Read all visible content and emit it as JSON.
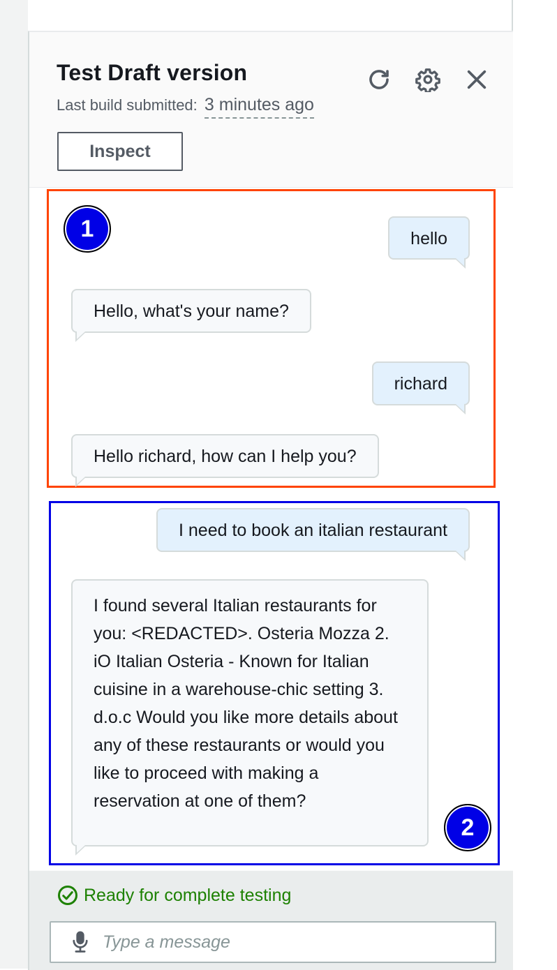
{
  "panel": {
    "title": "Test Draft version",
    "build_label": "Last build submitted:",
    "build_time": "3 minutes ago",
    "inspect_label": "Inspect",
    "icons": [
      "refresh-icon",
      "settings-gear-icon",
      "close-icon"
    ]
  },
  "annotations": {
    "badge1": "1",
    "badge2": "2",
    "colors": {
      "group1_border": "#ff4400",
      "group2_border": "#0000e6",
      "badge_fill": "#0000e6"
    }
  },
  "messages": [
    {
      "role": "user",
      "text": "hello"
    },
    {
      "role": "bot",
      "text": "Hello, what's your name?"
    },
    {
      "role": "user",
      "text": "richard"
    },
    {
      "role": "bot",
      "text": "Hello richard, how can I help you?"
    },
    {
      "role": "user",
      "text": "I need to book an italian restaurant"
    },
    {
      "role": "bot",
      "text": "I found several Italian restaurants for you: <REDACTED>. Osteria Mozza 2. iO Italian Osteria - Known for Italian cuisine in a warehouse-chic setting 3. d.o.c Would you like more details about any of these restaurants or would you like to proceed with making a reservation at one of them?"
    }
  ],
  "footer": {
    "status": "Ready for complete testing",
    "status_color": "#1d8102",
    "input_placeholder": "Type a message",
    "input_value": ""
  }
}
